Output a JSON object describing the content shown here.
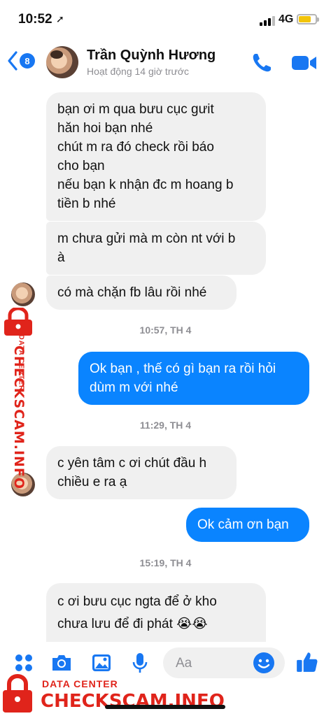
{
  "status_bar": {
    "time": "10:52",
    "network": "4G",
    "battery_level": 0.75
  },
  "header": {
    "unread_count": "8",
    "contact_name": "Trần Quỳnh Hương",
    "contact_status": "Hoạt động 14 giờ trước",
    "icons": [
      "back-chevron-icon",
      "phone-icon",
      "video-camera-icon"
    ]
  },
  "messages": [
    {
      "side": "in",
      "lines": [
        "bạn ơi m qua bưu cục gưit",
        "hăn hoi bạn nhé",
        "chút m ra đó check rồi báo",
        "cho bạn",
        "nếu bạn k nhận đc m hoang b",
        "tiền b nhé"
      ]
    },
    {
      "side": "in",
      "lines": [
        "m chưa gửi mà m còn nt với b",
        "à"
      ]
    },
    {
      "side": "in",
      "lines": [
        "có mà chặn fb lâu rồi nhé"
      ]
    },
    {
      "side": "ts",
      "text": "10:57, TH 4"
    },
    {
      "side": "out",
      "lines": [
        "Ok bạn , thế có gì bạn ra rồi hỏi",
        "dùm m với nhé"
      ]
    },
    {
      "side": "ts",
      "text": "11:29, TH 4"
    },
    {
      "side": "in",
      "lines": [
        "c yên tâm c ơi chút đầu h",
        "chiều e ra ạ"
      ]
    },
    {
      "side": "out",
      "lines": [
        "Ok cảm ơn bạn"
      ]
    },
    {
      "side": "ts",
      "text": "15:19, TH 4"
    },
    {
      "side": "in",
      "lines": [
        "c ơi bưu cục ngta để ở kho",
        "chưa lưu để đi phát 😭😭"
      ]
    }
  ],
  "composer": {
    "placeholder": "Aa",
    "icons": [
      "menu-dots-icon",
      "camera-icon",
      "gallery-icon",
      "microphone-icon",
      "emoji-icon",
      "thumbs-up-icon"
    ]
  },
  "watermark": {
    "label_small": "DATA CENTER",
    "label_brand": "CHECKSCAM.INFO",
    "color": "#e0241b"
  },
  "colors": {
    "accent": "#0a84ff",
    "incoming_bubble": "#f0f0f0"
  }
}
